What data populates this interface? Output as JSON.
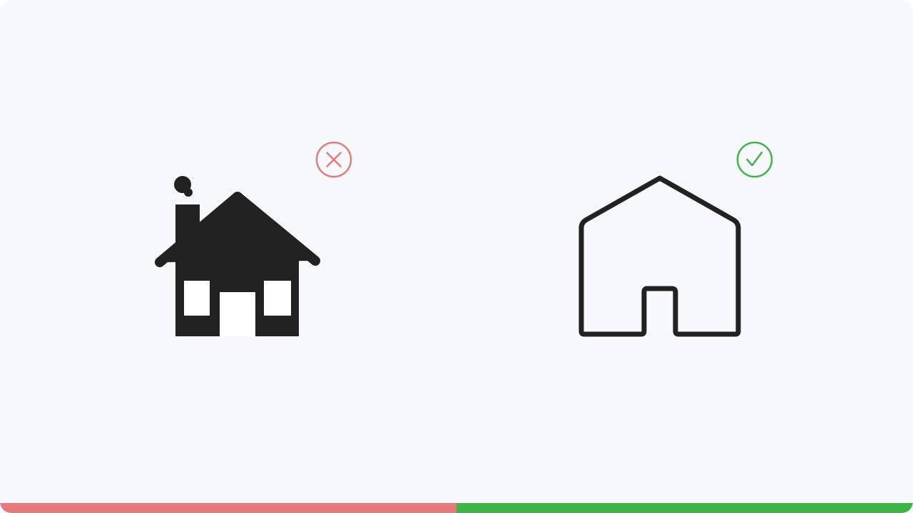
{
  "colors": {
    "background": "#f6f8fb",
    "icon_fill": "#222222",
    "icon_cutout": "#ffffff",
    "wrong": "#e57a7a",
    "right": "#3db34a"
  },
  "examples": [
    {
      "verdict": "wrong",
      "status_icon": "x-circle-icon",
      "illustration": "filled-detailed-house-icon"
    },
    {
      "verdict": "right",
      "status_icon": "check-circle-icon",
      "illustration": "outline-simple-house-icon"
    }
  ]
}
